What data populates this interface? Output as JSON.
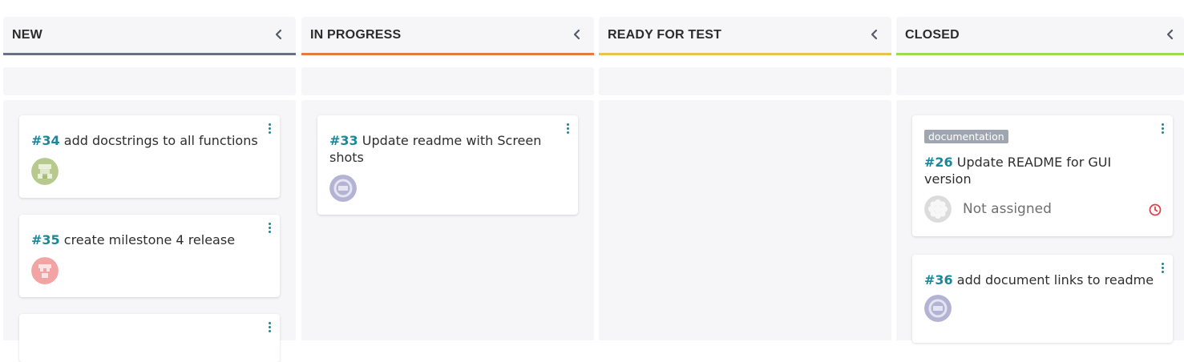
{
  "columns": [
    {
      "title": "NEW",
      "color": "#6b7089",
      "cards": [
        {
          "number": "#34",
          "title": "add docstrings to all functions"
        },
        {
          "number": "#35",
          "title": "create milestone 4 release"
        }
      ]
    },
    {
      "title": "IN PROGRESS",
      "color": "#e07b46",
      "cards": [
        {
          "number": "#33",
          "title": "Update readme with Screen shots"
        }
      ]
    },
    {
      "title": "READY FOR TEST",
      "color": "#e5c54b",
      "cards": []
    },
    {
      "title": "CLOSED",
      "color": "#9fd94f",
      "cards": [
        {
          "number": "#26",
          "title": "Update README for GUI version",
          "tag": "documentation",
          "assignee": "Not assigned"
        },
        {
          "number": "#36",
          "title": "add document links to readme"
        }
      ]
    }
  ],
  "icons": {
    "collapse": "chevron-left-icon",
    "menu": "kebab-menu-icon",
    "due": "clock-icon"
  },
  "colors": {
    "issue_number": "#17899b",
    "due_icon": "#e0404a",
    "tag_bg": "#9fa6b2"
  }
}
